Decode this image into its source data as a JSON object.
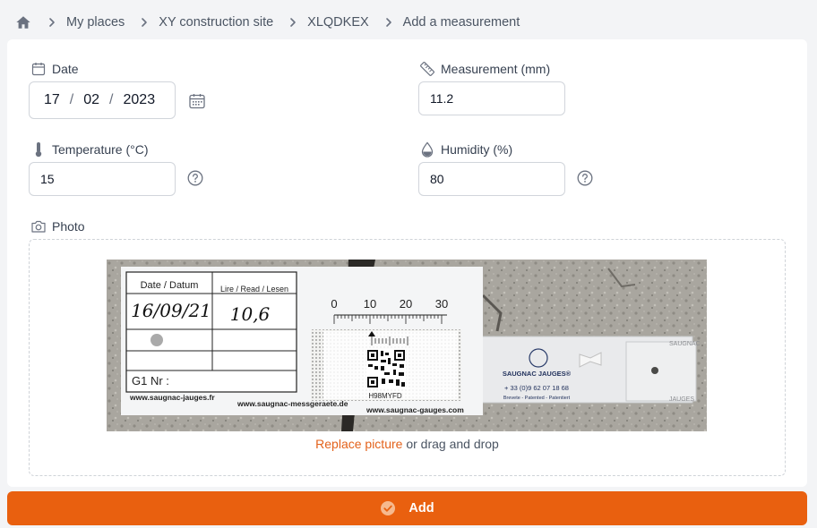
{
  "breadcrumb": {
    "items": [
      "My places",
      "XY construction site",
      "XLQDKEX",
      "Add a measurement"
    ]
  },
  "form": {
    "date": {
      "label": "Date",
      "day": "17",
      "month": "02",
      "year": "2023",
      "sep": "/"
    },
    "measurement": {
      "label": "Measurement (mm)",
      "value": "11.2"
    },
    "temperature": {
      "label": "Temperature (°C)",
      "value": "15"
    },
    "humidity": {
      "label": "Humidity (%)",
      "value": "80"
    },
    "photo": {
      "label": "Photo",
      "replace_link": "Replace picture",
      "drag_text": " or drag and drop"
    }
  },
  "photo_content": {
    "card_date_header": "Date / Datum",
    "card_read_header": "Lire / Read / Lesen",
    "card_date_value": "16/09/21",
    "card_read_value": "10,6",
    "card_g1": "G1  Nr :",
    "card_url_1": "www.saugnac-jauges.fr",
    "card_url_2": "www.saugnac-messgeraete.de",
    "card_url_3": "www.saugnac-gauges.com",
    "scale_0": "0",
    "scale_10": "10",
    "scale_20": "20",
    "scale_30": "30",
    "qr_code": "H98MYFD",
    "brand": "SAUGNAC JAUGES®",
    "phone": "+ 33 (0)9 62 07 18 68",
    "patent": "Brevete - Patented - Patentiert",
    "brand_side": "SAUGNAC",
    "brand_side2": "JAUGES"
  },
  "actions": {
    "add_label": "Add"
  },
  "colors": {
    "accent": "#e9600f",
    "link": "#e3621b",
    "border": "#d1d5db"
  }
}
